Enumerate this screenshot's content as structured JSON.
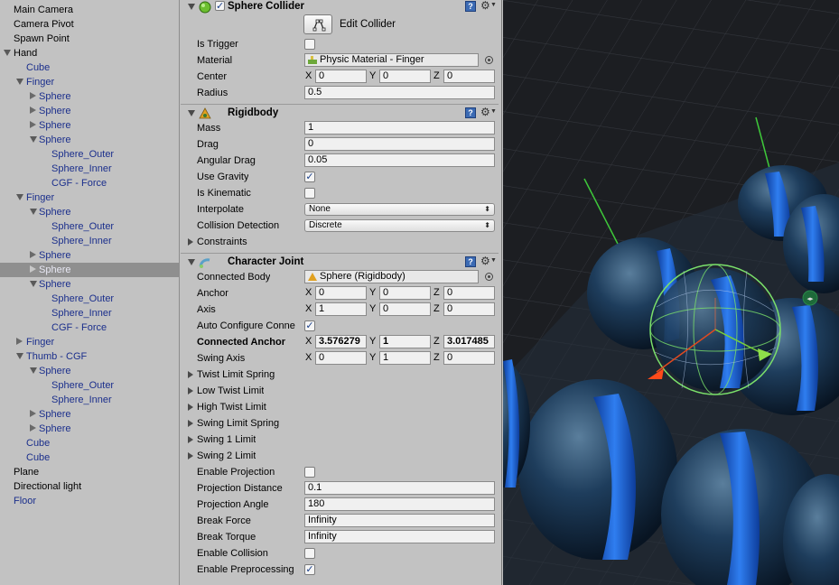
{
  "hierarchy": {
    "items": [
      {
        "label": "Main Camera",
        "type": "obj",
        "depth": 0,
        "arrow": "none"
      },
      {
        "label": "Camera Pivot",
        "type": "obj",
        "depth": 0,
        "arrow": "none"
      },
      {
        "label": "Spawn Point",
        "type": "obj",
        "depth": 0,
        "arrow": "none"
      },
      {
        "label": "Hand",
        "type": "obj",
        "depth": 0,
        "arrow": "open"
      },
      {
        "label": "Cube",
        "type": "prefab",
        "depth": 1,
        "arrow": "none"
      },
      {
        "label": "Finger",
        "type": "prefab",
        "depth": 1,
        "arrow": "open"
      },
      {
        "label": "Sphere",
        "type": "prefab",
        "depth": 2,
        "arrow": "closed"
      },
      {
        "label": "Sphere",
        "type": "prefab",
        "depth": 2,
        "arrow": "closed"
      },
      {
        "label": "Sphere",
        "type": "prefab",
        "depth": 2,
        "arrow": "closed"
      },
      {
        "label": "Sphere",
        "type": "prefab",
        "depth": 2,
        "arrow": "open"
      },
      {
        "label": "Sphere_Outer",
        "type": "prefab",
        "depth": 3,
        "arrow": "none"
      },
      {
        "label": "Sphere_Inner",
        "type": "prefab",
        "depth": 3,
        "arrow": "none"
      },
      {
        "label": "CGF - Force",
        "type": "prefab",
        "depth": 3,
        "arrow": "none"
      },
      {
        "label": "Finger",
        "type": "prefab",
        "depth": 1,
        "arrow": "open"
      },
      {
        "label": "Sphere",
        "type": "prefab",
        "depth": 2,
        "arrow": "open"
      },
      {
        "label": "Sphere_Outer",
        "type": "prefab",
        "depth": 3,
        "arrow": "none"
      },
      {
        "label": "Sphere_Inner",
        "type": "prefab",
        "depth": 3,
        "arrow": "none"
      },
      {
        "label": "Sphere",
        "type": "prefab",
        "depth": 2,
        "arrow": "closed"
      },
      {
        "label": "Sphere",
        "type": "prefab",
        "depth": 2,
        "arrow": "closed",
        "selected": true
      },
      {
        "label": "Sphere",
        "type": "prefab",
        "depth": 2,
        "arrow": "open"
      },
      {
        "label": "Sphere_Outer",
        "type": "prefab",
        "depth": 3,
        "arrow": "none"
      },
      {
        "label": "Sphere_Inner",
        "type": "prefab",
        "depth": 3,
        "arrow": "none"
      },
      {
        "label": "CGF - Force",
        "type": "prefab",
        "depth": 3,
        "arrow": "none"
      },
      {
        "label": "Finger",
        "type": "prefab",
        "depth": 1,
        "arrow": "closed"
      },
      {
        "label": "Thumb - CGF",
        "type": "prefab",
        "depth": 1,
        "arrow": "open"
      },
      {
        "label": "Sphere",
        "type": "prefab",
        "depth": 2,
        "arrow": "open"
      },
      {
        "label": "Sphere_Outer",
        "type": "prefab",
        "depth": 3,
        "arrow": "none"
      },
      {
        "label": "Sphere_Inner",
        "type": "prefab",
        "depth": 3,
        "arrow": "none"
      },
      {
        "label": "Sphere",
        "type": "prefab",
        "depth": 2,
        "arrow": "closed"
      },
      {
        "label": "Sphere",
        "type": "prefab",
        "depth": 2,
        "arrow": "closed"
      },
      {
        "label": "Cube",
        "type": "prefab",
        "depth": 1,
        "arrow": "none"
      },
      {
        "label": "Cube",
        "type": "prefab",
        "depth": 1,
        "arrow": "none"
      },
      {
        "label": "Plane",
        "type": "obj",
        "depth": 0,
        "arrow": "none"
      },
      {
        "label": "Directional light",
        "type": "obj",
        "depth": 0,
        "arrow": "none"
      },
      {
        "label": "Floor",
        "type": "prefab",
        "depth": 0,
        "arrow": "none"
      }
    ]
  },
  "inspector": {
    "sphere_collider": {
      "title": "Sphere Collider",
      "enabled": true,
      "edit_label": "Edit Collider",
      "is_trigger_label": "Is Trigger",
      "is_trigger": false,
      "material_label": "Material",
      "material_value": "Physic Material - Finger",
      "center_label": "Center",
      "center": {
        "x": "0",
        "y": "0",
        "z": "0"
      },
      "radius_label": "Radius",
      "radius": "0.5"
    },
    "rigidbody": {
      "title": "Rigidbody",
      "mass_label": "Mass",
      "mass": "1",
      "drag_label": "Drag",
      "drag": "0",
      "angular_drag_label": "Angular Drag",
      "angular_drag": "0.05",
      "use_gravity_label": "Use Gravity",
      "use_gravity": true,
      "is_kinematic_label": "Is Kinematic",
      "is_kinematic": false,
      "interpolate_label": "Interpolate",
      "interpolate": "None",
      "collision_label": "Collision Detection",
      "collision": "Discrete",
      "constraints_label": "Constraints"
    },
    "character_joint": {
      "title": "Character Joint",
      "connected_body_label": "Connected Body",
      "connected_body": "Sphere (Rigidbody)",
      "anchor_label": "Anchor",
      "anchor": {
        "x": "0",
        "y": "0",
        "z": "0"
      },
      "axis_label": "Axis",
      "axis": {
        "x": "1",
        "y": "0",
        "z": "0"
      },
      "auto_configure_label": "Auto Configure Conne",
      "auto_configure": true,
      "connected_anchor_label": "Connected Anchor",
      "connected_anchor": {
        "x": "3.576279",
        "y": "1",
        "z": "3.017485"
      },
      "swing_axis_label": "Swing Axis",
      "swing_axis": {
        "x": "0",
        "y": "1",
        "z": "0"
      },
      "foldouts": [
        "Twist Limit Spring",
        "Low Twist Limit",
        "High Twist Limit",
        "Swing Limit Spring",
        "Swing 1 Limit",
        "Swing 2 Limit"
      ],
      "enable_projection_label": "Enable Projection",
      "enable_projection": false,
      "projection_distance_label": "Projection Distance",
      "projection_distance": "0.1",
      "projection_angle_label": "Projection Angle",
      "projection_angle": "180",
      "break_force_label": "Break Force",
      "break_force": "Infinity",
      "break_torque_label": "Break Torque",
      "break_torque": "Infinity",
      "enable_collision_label": "Enable Collision",
      "enable_collision": false,
      "enable_preprocessing_label": "Enable Preprocessing",
      "enable_preprocessing": true
    },
    "axis_letters": {
      "x": "X",
      "y": "Y",
      "z": "Z"
    },
    "check_glyph": "✓",
    "help_glyph": "?",
    "gear_glyph": "⚙"
  },
  "colors": {
    "panel_bg": "#c2c2c2",
    "prefab_text": "#1b2f8c",
    "selection": "#8f8f8f",
    "scene_bg": "#1a1c20",
    "sphere_blue": "#2a6fd6"
  }
}
